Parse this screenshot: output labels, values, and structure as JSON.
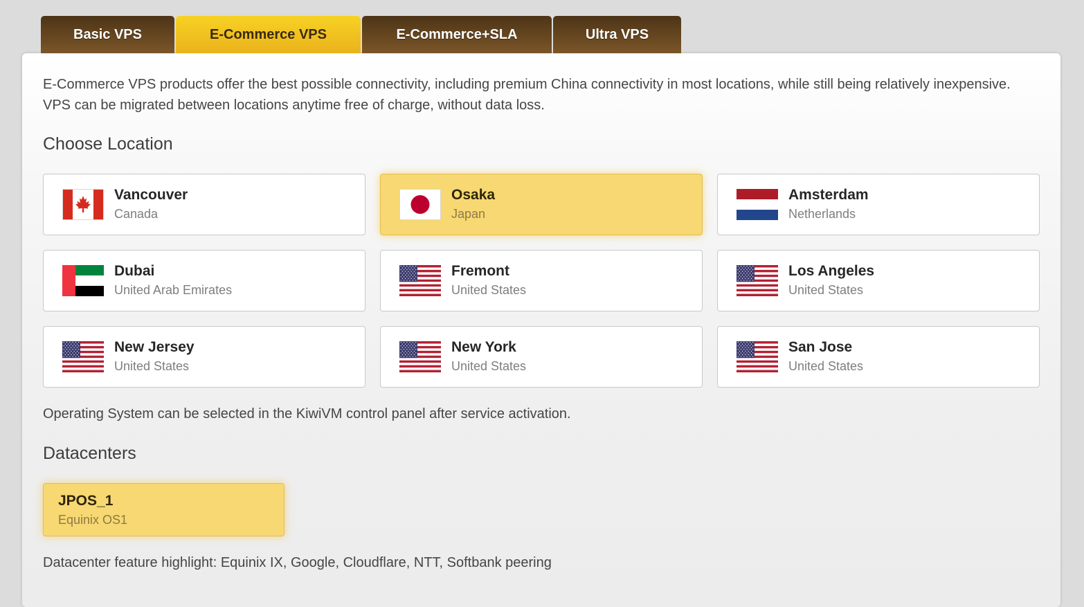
{
  "tabs": [
    {
      "label": "Basic VPS"
    },
    {
      "label": "E-Commerce VPS"
    },
    {
      "label": "E-Commerce+SLA"
    },
    {
      "label": "Ultra VPS"
    }
  ],
  "active_tab": "E-Commerce VPS",
  "intro": "E-Commerce VPS products offer the best possible connectivity, including premium China connectivity in most locations, while still being relatively inexpensive. VPS can be migrated between locations anytime free of charge, without data loss.",
  "location_section": {
    "title": "Choose Location"
  },
  "locations": [
    {
      "city": "Vancouver",
      "country": "Canada",
      "flag": "canada-flag-icon",
      "selected": false
    },
    {
      "city": "Osaka",
      "country": "Japan",
      "flag": "japan-flag-icon",
      "selected": true
    },
    {
      "city": "Amsterdam",
      "country": "Netherlands",
      "flag": "netherlands-flag-icon",
      "selected": false
    },
    {
      "city": "Dubai",
      "country": "United Arab Emirates",
      "flag": "uae-flag-icon",
      "selected": false
    },
    {
      "city": "Fremont",
      "country": "United States",
      "flag": "usa-flag-icon",
      "selected": false
    },
    {
      "city": "Los Angeles",
      "country": "United States",
      "flag": "usa-flag-icon",
      "selected": false
    },
    {
      "city": "New Jersey",
      "country": "United States",
      "flag": "usa-flag-icon",
      "selected": false
    },
    {
      "city": "New York",
      "country": "United States",
      "flag": "usa-flag-icon",
      "selected": false
    },
    {
      "city": "San Jose",
      "country": "United States",
      "flag": "usa-flag-icon",
      "selected": false
    }
  ],
  "os_note": "Operating System can be selected in the KiwiVM control panel after service activation.",
  "datacenter_section": {
    "title": "Datacenters"
  },
  "datacenter": {
    "name": "JPOS_1",
    "facility": "Equinix OS1",
    "selected": true
  },
  "datacenter_note": "Datacenter feature highlight: Equinix IX, Google, Cloudflare, NTT, Softbank peering",
  "colors": {
    "tab_inactive": "#6b4a22",
    "tab_active": "#f2c21f",
    "selected_card": "#f7d872",
    "panel_background": "#f4f4f4"
  }
}
